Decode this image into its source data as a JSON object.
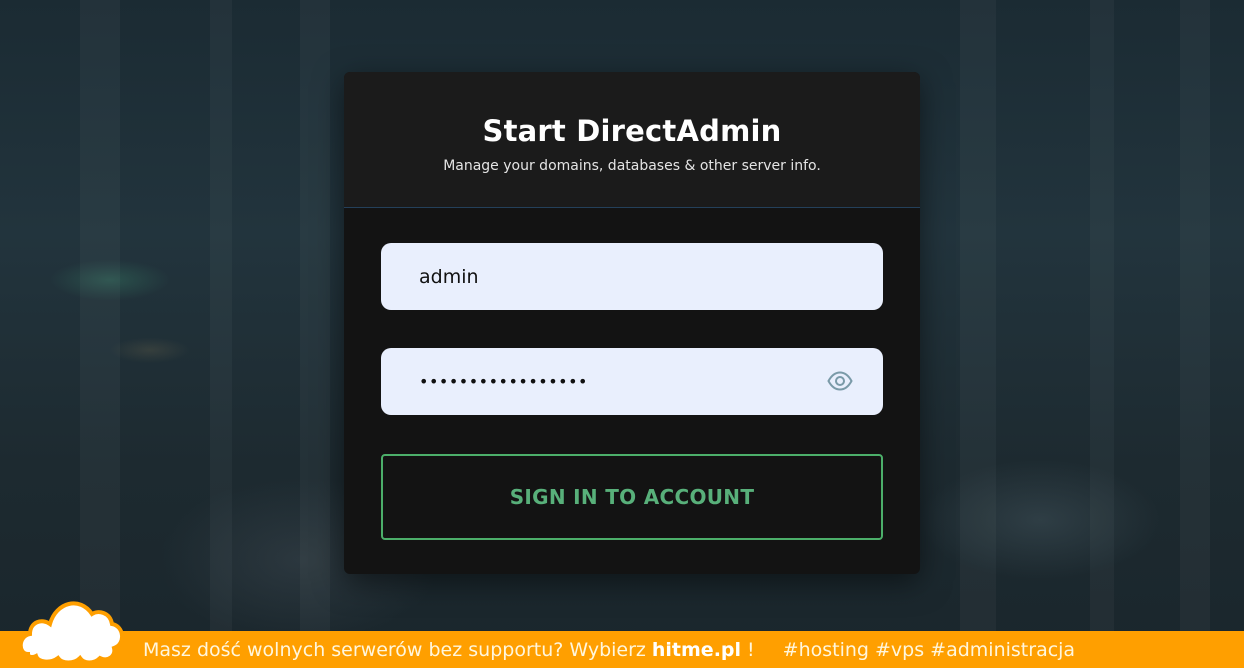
{
  "login": {
    "title": "Start DirectAdmin",
    "subtitle": "Manage your domains, databases & other server info.",
    "username_value": "admin",
    "password_masked": "•••••••••••••••••",
    "sign_in_label": "SIGN IN TO ACCOUNT"
  },
  "promo": {
    "text": "Masz dość wolnych serwerów bez supportu? Wybierz",
    "brand": "hitme.pl",
    "exclamation": "!",
    "tags": "#hosting #vps #administracja"
  },
  "icons": {
    "password_toggle": "eye-icon",
    "logo": "cloud-logo-icon"
  },
  "colors": {
    "accent_green": "#4caf6a",
    "promo_orange": "#ff9f00",
    "field_bg": "#e9effd",
    "card_bg": "#131313"
  }
}
